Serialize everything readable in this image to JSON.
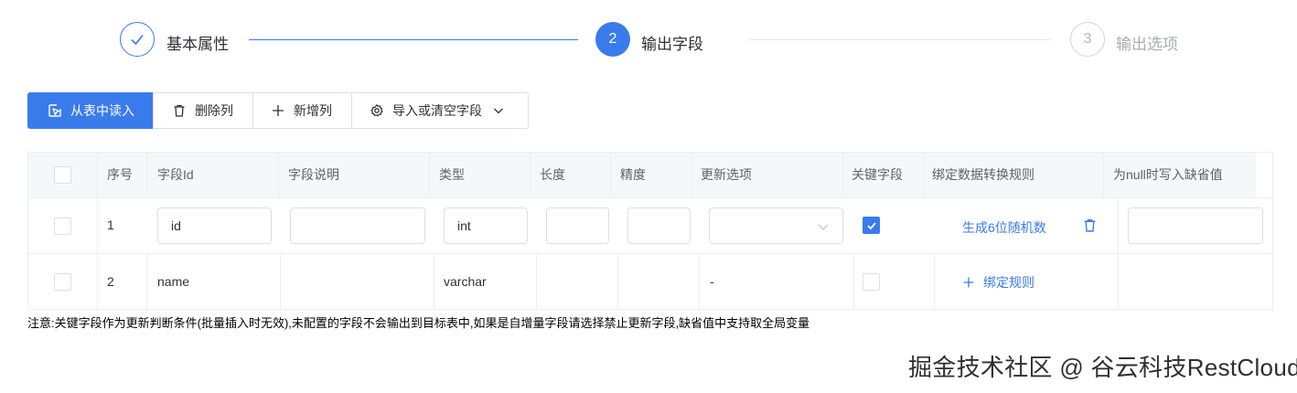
{
  "steps": [
    {
      "index": "",
      "title": "基本属性",
      "status": "finished"
    },
    {
      "index": "2",
      "title": "输出字段",
      "status": "active"
    },
    {
      "index": "3",
      "title": "输出选项",
      "status": "wait"
    }
  ],
  "toolbar": {
    "read_from_table": "从表中读入",
    "delete_column": "删除列",
    "add_column": "新增列",
    "import_or_clear": "导入或清空字段"
  },
  "table": {
    "columns": [
      "序号",
      "字段Id",
      "字段说明",
      "类型",
      "长度",
      "精度",
      "更新选项",
      "关键字段",
      "绑定数据转换规则",
      "为null时写入缺省值"
    ],
    "rows": [
      {
        "index": "1",
        "field_id": "id",
        "description": "",
        "type": "int",
        "length": "",
        "precision": "",
        "update_option": "",
        "key_field": true,
        "rule": "生成6位随机数",
        "default_value": ""
      },
      {
        "index": "2",
        "field_id": "name",
        "description": "",
        "type": "varchar",
        "length": "",
        "precision": "",
        "update_option": "-",
        "key_field": false,
        "rule": "绑定规则",
        "default_value": ""
      }
    ]
  },
  "note": "注意:关键字段作为更新判断条件(批量插入时无效),未配置的字段不会输出到目标表中,如果是自增量字段请选择禁止更新字段,缺省值中支持取全局变量",
  "watermark": "掘金技术社区 @ 谷云科技RestCloud",
  "colors": {
    "primary": "#3a7bec",
    "border": "#dcdfe6",
    "header_bg": "#f5f7fa"
  }
}
